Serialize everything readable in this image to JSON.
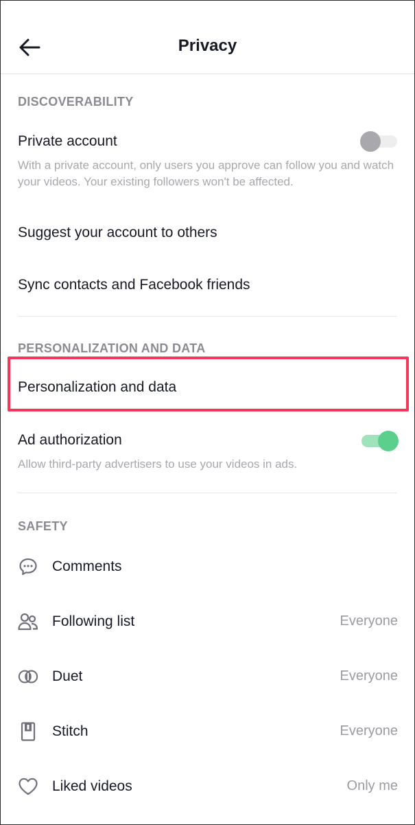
{
  "header": {
    "title": "Privacy",
    "back_icon": "arrow-left-icon"
  },
  "discoverability": {
    "section_title": "DISCOVERABILITY",
    "private_account": {
      "label": "Private account",
      "description": "With a private account, only users you approve can follow you and watch your videos. Your existing followers won't be affected.",
      "enabled": false
    },
    "suggest_label": "Suggest your account to others",
    "sync_label": "Sync contacts and Facebook friends"
  },
  "personalization": {
    "section_title": "PERSONALIZATION AND DATA",
    "item_label": "Personalization and data",
    "ad_authorization": {
      "label": "Ad authorization",
      "description": "Allow third-party advertisers to use your videos in ads.",
      "enabled": true
    }
  },
  "safety": {
    "section_title": "SAFETY",
    "items": [
      {
        "label": "Comments",
        "value": "",
        "icon": "comment-bubble-icon"
      },
      {
        "label": "Following list",
        "value": "Everyone",
        "icon": "people-icon"
      },
      {
        "label": "Duet",
        "value": "Everyone",
        "icon": "duet-icon"
      },
      {
        "label": "Stitch",
        "value": "Everyone",
        "icon": "stitch-icon"
      },
      {
        "label": "Liked videos",
        "value": "Only me",
        "icon": "heart-icon"
      }
    ]
  },
  "colors": {
    "highlight": "#f4365a",
    "toggle_on": "#5ad08c",
    "toggle_off": "#a9a9ad"
  }
}
